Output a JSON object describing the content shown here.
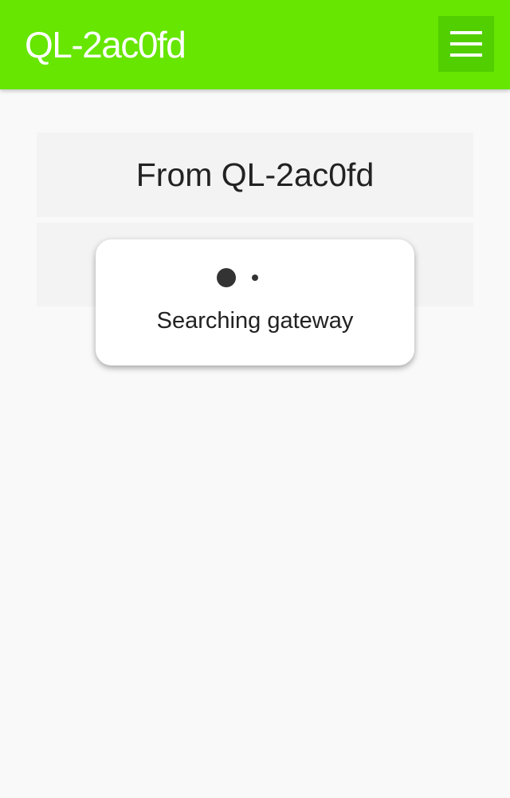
{
  "header": {
    "title": "QL-2ac0fd",
    "menu_icon": "hamburger-menu-icon",
    "background_color": "#66e600"
  },
  "main": {
    "card_title": "From QL-2ac0fd"
  },
  "loading_dialog": {
    "message": "Searching gateway",
    "spinner_icon": "loading-dots-icon"
  }
}
